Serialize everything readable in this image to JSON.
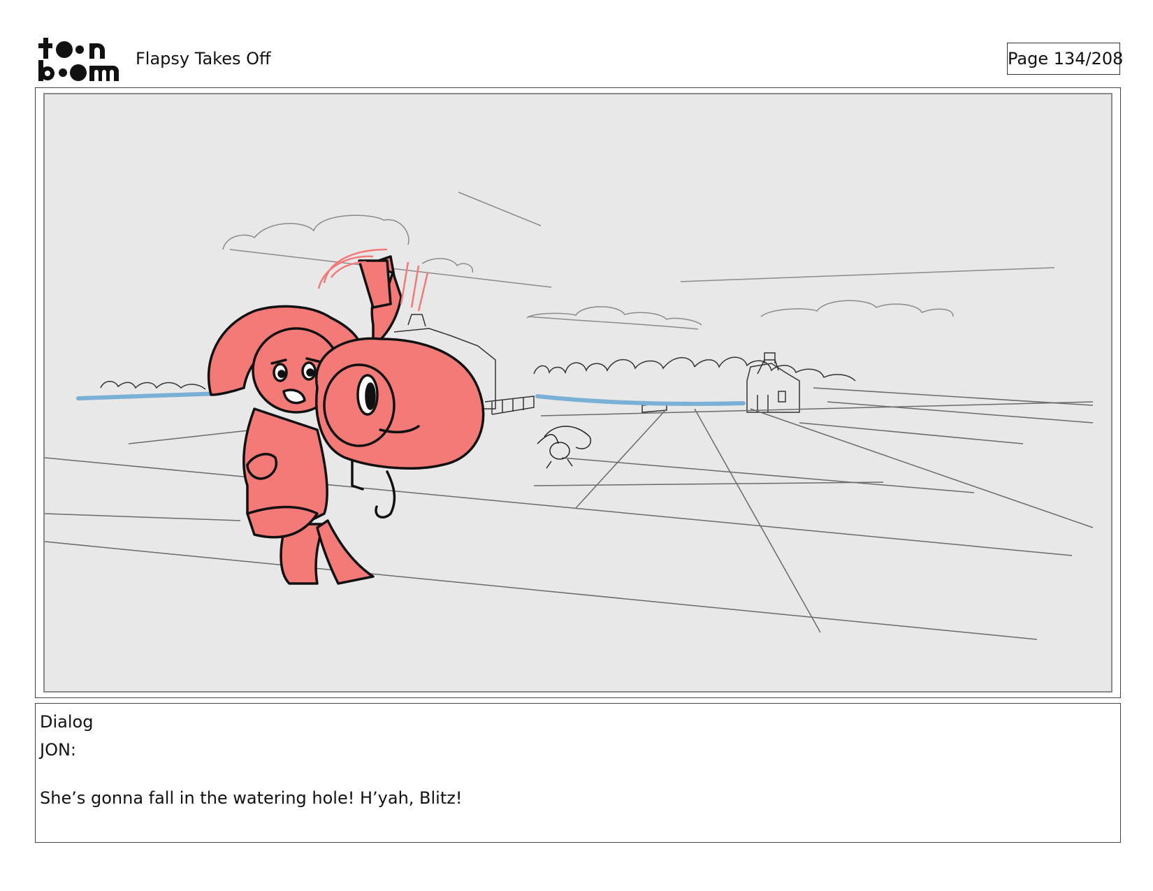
{
  "header": {
    "logo_text": "toon boom",
    "title": "Flapsy Takes Off",
    "page_label": "Page 134/208"
  },
  "colors": {
    "character_fill": "#f47a78",
    "character_outline": "#111111",
    "water": "#7ab0d6",
    "panel_background": "#e8e8e8",
    "sketch_line": "#555555"
  },
  "panel": {
    "description_icon": "storyboard-sketch"
  },
  "dialog": {
    "heading": "Dialog",
    "speaker": "JON:",
    "line": "She’s gonna fall in the watering hole! H’yah, Blitz!"
  }
}
